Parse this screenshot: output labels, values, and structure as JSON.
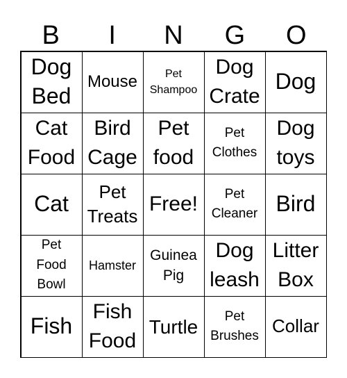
{
  "header": [
    "B",
    "I",
    "N",
    "G",
    "O"
  ],
  "cells": [
    "Dog\nBed",
    "Mouse",
    "Pet\nShampoo",
    "Dog\nCrate",
    "Dog",
    "Cat\nFood",
    "Bird\nCage",
    "Pet\nfood",
    "Pet\nClothes",
    "Dog\ntoys",
    "Cat",
    "Pet\nTreats",
    "Free!",
    "Pet\nCleaner",
    "Bird",
    "Pet\nFood\nBowl",
    "Hamster",
    "Guinea\nPig",
    "Dog\nleash",
    "Litter\nBox",
    "Fish",
    "Fish\nFood",
    "Turtle",
    "Pet\nBrushes",
    "Collar"
  ]
}
